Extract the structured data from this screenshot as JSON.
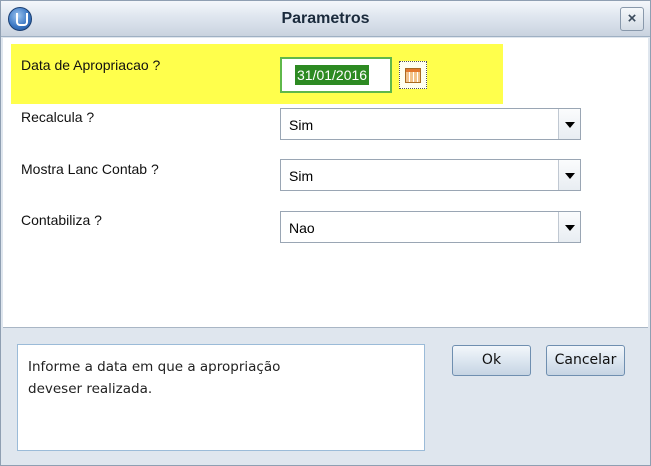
{
  "window": {
    "title": "Parametros",
    "close_label": "×"
  },
  "fields": [
    {
      "label": "Data de Apropriacao ?",
      "value": "31/01/2016",
      "type": "date"
    },
    {
      "label": "Recalcula ?",
      "value": "Sim",
      "type": "select"
    },
    {
      "label": "Mostra Lanc Contab ?",
      "value": "Sim",
      "type": "select"
    },
    {
      "label": "Contabiliza ?",
      "value": "Nao",
      "type": "select"
    }
  ],
  "help": {
    "text_line1": "Informe a data em que a apropriação",
    "text_line2": "deveser realizada."
  },
  "buttons": {
    "ok_label": "Ok",
    "cancel_label": "Cancelar"
  },
  "colors": {
    "highlight": "#ffff4c",
    "date_border": "#5fb84a",
    "date_selection": "#2d8a22"
  },
  "icons": {
    "app": "app-logo-icon",
    "calendar": "calendar-icon",
    "dropdown": "chevron-down-icon"
  }
}
